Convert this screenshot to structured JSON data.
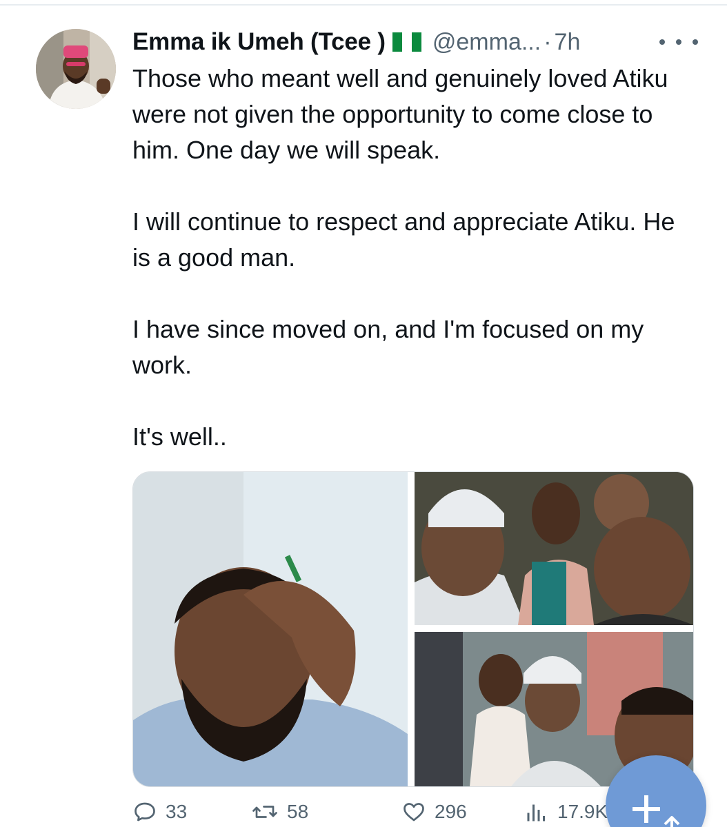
{
  "tweet": {
    "author_name": "Emma ik Umeh (Tcee )",
    "flag_icon": "nigeria-flag-icon",
    "handle": "@emma...",
    "dot": "·",
    "time": "7h",
    "paragraphs": [
      "Those who meant well and genuinely loved Atiku were not given the opportunity to come close to him. One day we will speak.",
      "I will continue to respect and appreciate Atiku. He is a good man.",
      "I have since moved on, and I'm focused on my work.",
      "It's well.."
    ]
  },
  "stats": {
    "replies": "33",
    "retweets": "58",
    "likes": "296",
    "views": "17.9K"
  },
  "colors": {
    "text": "#0f1419",
    "secondary": "#536471",
    "fab": "#6f9ad6",
    "flag_green": "#0b8a3e"
  }
}
